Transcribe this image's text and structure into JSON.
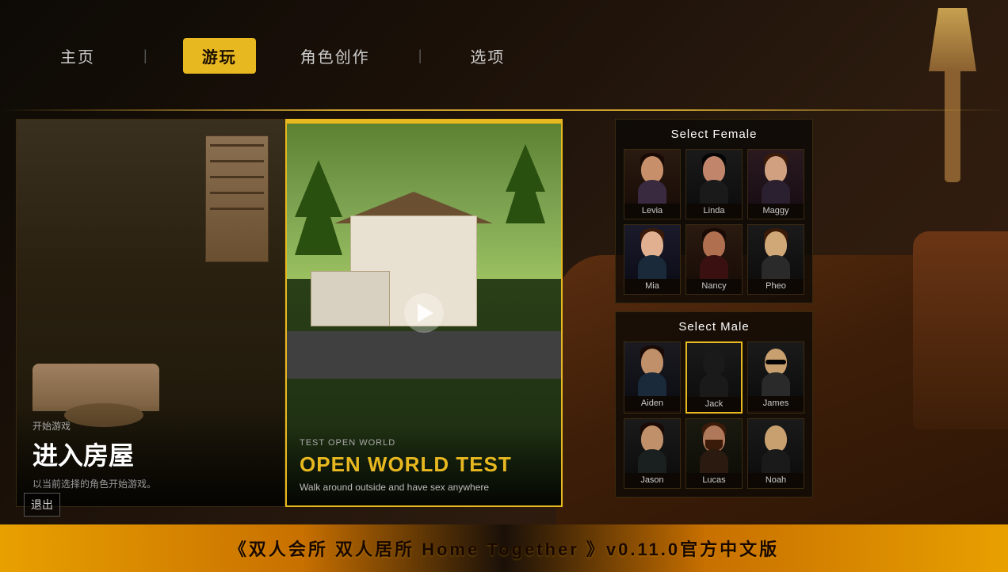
{
  "nav": {
    "items": [
      {
        "id": "home",
        "label": "主页",
        "active": false
      },
      {
        "id": "play",
        "label": "游玩",
        "active": true
      },
      {
        "id": "character",
        "label": "角色创作",
        "active": false
      },
      {
        "id": "options",
        "label": "选项",
        "active": false
      }
    ]
  },
  "cards": {
    "house": {
      "subtitle": "开始游戏",
      "title": "进入房屋",
      "description": "以当前选择的角色开始游戏。"
    },
    "open_world": {
      "tag": "TEST OPEN WORLD",
      "title": "OPEN WORLD TEST",
      "description": "Walk around outside and have sex anywhere"
    }
  },
  "character_select": {
    "female_title": "Select Female",
    "male_title": "Select Male",
    "females": [
      {
        "id": "levia",
        "name": "Levia",
        "selected": false
      },
      {
        "id": "linda",
        "name": "Linda",
        "selected": false
      },
      {
        "id": "maggy",
        "name": "Maggy",
        "selected": false
      },
      {
        "id": "mia",
        "name": "Mia",
        "selected": false
      },
      {
        "id": "nancy",
        "name": "Nancy",
        "selected": false
      },
      {
        "id": "pheo",
        "name": "Pheo",
        "selected": false
      }
    ],
    "males": [
      {
        "id": "aiden",
        "name": "Aiden",
        "selected": false
      },
      {
        "id": "jack",
        "name": "Jack",
        "selected": true
      },
      {
        "id": "james",
        "name": "James",
        "selected": false
      },
      {
        "id": "jason",
        "name": "Jason",
        "selected": false
      },
      {
        "id": "lucas",
        "name": "Lucas",
        "selected": false
      },
      {
        "id": "noah",
        "name": "Noah",
        "selected": false
      }
    ]
  },
  "footer": {
    "title": "《双人会所 双人居所 Home Together 》v0.11.0官方中文版"
  },
  "logout": {
    "label": "退出"
  }
}
